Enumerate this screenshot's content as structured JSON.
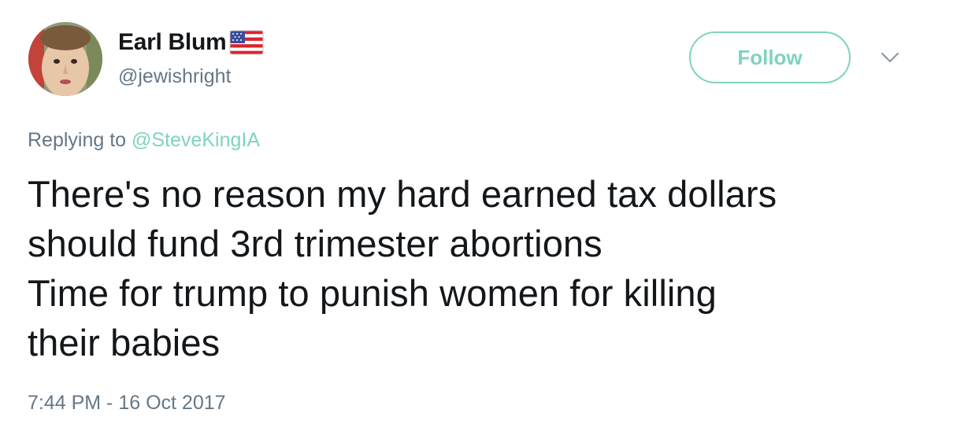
{
  "author": {
    "display_name": "Earl Blum",
    "handle": "@jewishright",
    "avatar_icon": "profile-photo",
    "badge_icon": "us-flag-icon"
  },
  "actions": {
    "follow_label": "Follow",
    "menu_icon": "chevron-down-icon"
  },
  "reply": {
    "prefix": "Replying to",
    "to_handle": "@SteveKingIA"
  },
  "tweet": {
    "text": "There's no reason my hard earned tax dollars\nshould fund 3rd trimester abortions\nTime for trump to punish women for killing\ntheir babies",
    "timestamp": "7:44 PM - 16 Oct 2017"
  },
  "colors": {
    "accent": "#7fd3bf",
    "text": "#14171a",
    "muted": "#657786"
  }
}
